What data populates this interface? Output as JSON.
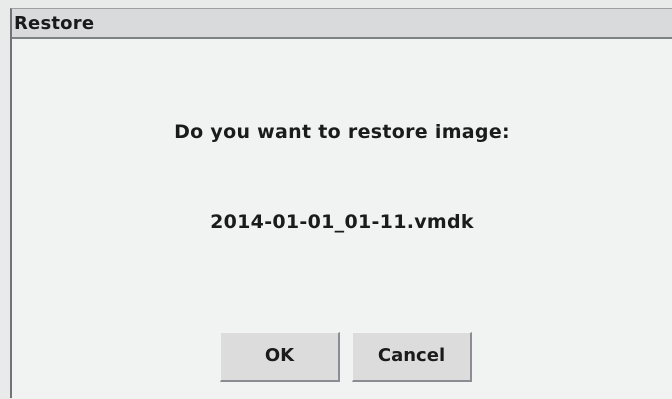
{
  "dialog": {
    "title": "Restore",
    "question": "Do you want to restore image:",
    "filename": "2014-01-01_01-11.vmdk",
    "ok_label": "OK",
    "cancel_label": "Cancel"
  }
}
